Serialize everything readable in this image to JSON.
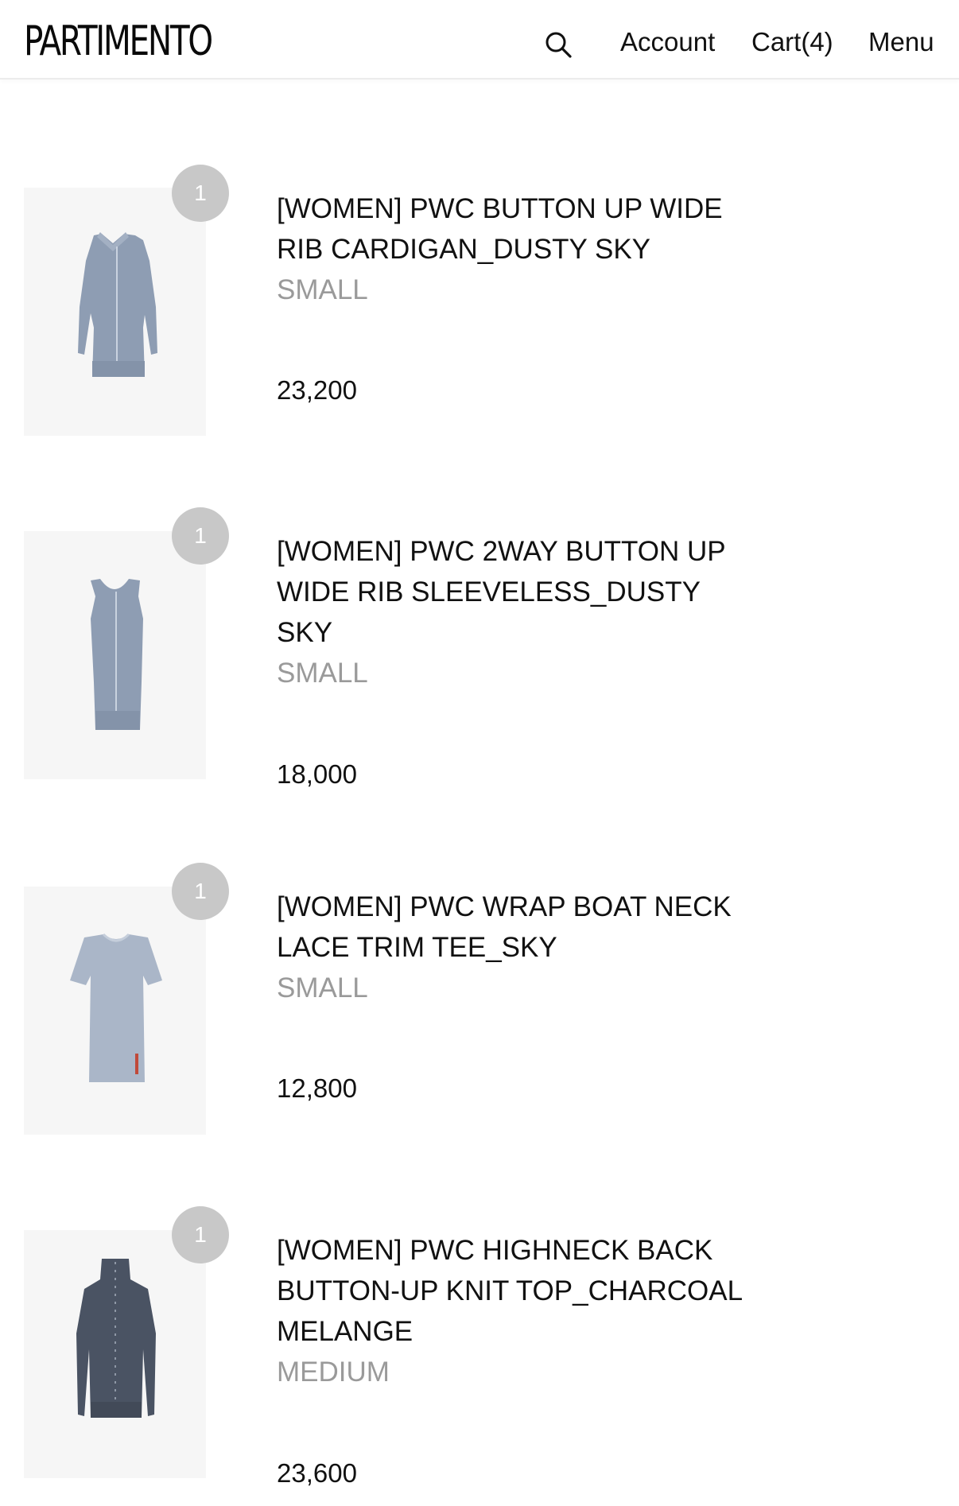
{
  "header": {
    "logo": "PARTIMENTO",
    "search_icon": "search-icon",
    "account_label": "Account",
    "cart_label": "Cart(4)",
    "menu_label": "Menu"
  },
  "cart": {
    "items": [
      {
        "quantity": "1",
        "title": "[WOMEN] PWC BUTTON UP WIDE RIB CARDIGAN_DUSTY SKY",
        "size": "SMALL",
        "price": "23,200",
        "image_icon": "cardigan-image",
        "color": "#8e9db3"
      },
      {
        "quantity": "1",
        "title": "[WOMEN] PWC 2WAY BUTTON UP WIDE RIB SLEEVELESS_DUSTY SKY",
        "size": "SMALL",
        "price": "18,000",
        "image_icon": "sleeveless-top-image",
        "color": "#8e9db3"
      },
      {
        "quantity": "1",
        "title": "[WOMEN] PWC WRAP BOAT NECK LACE TRIM TEE_SKY",
        "size": "SMALL",
        "price": "12,800",
        "image_icon": "tee-image",
        "color": "#aab6c8"
      },
      {
        "quantity": "1",
        "title": "[WOMEN] PWC HIGHNECK BACK BUTTON-UP KNIT TOP_CHARCOAL MELANGE",
        "size": "MEDIUM",
        "price": "23,600",
        "image_icon": "highneck-knit-image",
        "color": "#4a5363"
      }
    ]
  }
}
